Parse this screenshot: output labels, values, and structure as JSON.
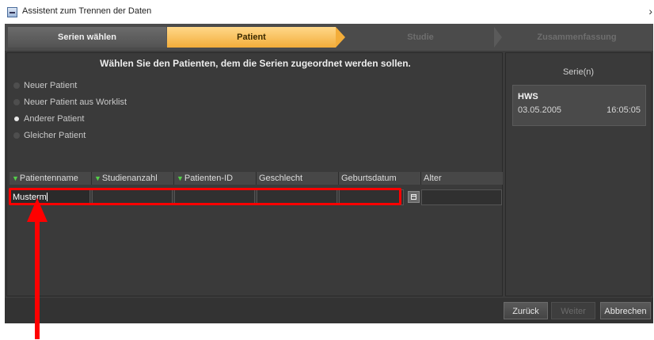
{
  "window": {
    "title": "Assistent zum Trennen der Daten",
    "close_glyph": "›"
  },
  "steps": [
    {
      "label": "Serien wählen",
      "state": "done"
    },
    {
      "label": "Patient",
      "state": "active"
    },
    {
      "label": "Studie",
      "state": "future"
    },
    {
      "label": "Zusammenfassung",
      "state": "future"
    }
  ],
  "main": {
    "heading": "Wählen Sie den Patienten, dem die Serien zugeordnet werden sollen.",
    "radios": [
      {
        "label": "Neuer Patient",
        "selected": false
      },
      {
        "label": "Neuer Patient aus Worklist",
        "selected": false
      },
      {
        "label": "Anderer Patient",
        "selected": true
      },
      {
        "label": "Gleicher Patient",
        "selected": false
      }
    ],
    "columns": [
      "Patientenname",
      "Studienanzahl",
      "Patienten-ID",
      "Geschlecht",
      "Geburtsdatum",
      "Alter"
    ],
    "filter_icon": "green-filter-triangle",
    "row": {
      "patientenname": "Musterm",
      "studienanzahl": "",
      "patienten_id": "",
      "geschlecht": "",
      "geburtsdatum": "",
      "alter": ""
    },
    "calendar_icon": "calendar-icon"
  },
  "side": {
    "header": "Serie(n)",
    "series": [
      {
        "name": "HWS",
        "date": "03.05.2005",
        "time": "16:05:05"
      }
    ]
  },
  "footer": {
    "back": "Zurück",
    "next": "Weiter",
    "cancel": "Abbrechen"
  },
  "colors": {
    "accent": "#f3ad3a",
    "highlight": "#ff0000",
    "filter": "#55d04a",
    "panel": "#3b3b3b"
  }
}
